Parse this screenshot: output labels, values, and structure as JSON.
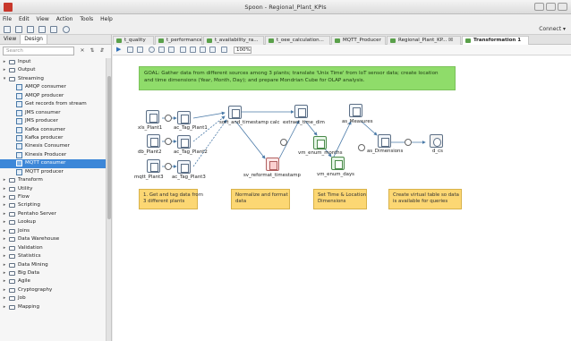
{
  "window": {
    "title": "Spoon - Regional_Plant_KPIs"
  },
  "menu": [
    "File",
    "Edit",
    "View",
    "Action",
    "Tools",
    "Help"
  ],
  "toolbar": {
    "connect_label": "Connect ▾"
  },
  "left_panel": {
    "tabs": [
      "View",
      "Design"
    ],
    "search_placeholder": "Search",
    "tree": [
      {
        "label": "Input",
        "type": "folder",
        "expanded": false
      },
      {
        "label": "Output",
        "type": "folder",
        "expanded": false
      },
      {
        "label": "Streaming",
        "type": "folder",
        "expanded": true
      },
      {
        "label": "AMQP consumer",
        "type": "step"
      },
      {
        "label": "AMQP producer",
        "type": "step"
      },
      {
        "label": "Get records from stream",
        "type": "step"
      },
      {
        "label": "JMS consumer",
        "type": "step"
      },
      {
        "label": "JMS producer",
        "type": "step"
      },
      {
        "label": "Kafka consumer",
        "type": "step"
      },
      {
        "label": "Kafka producer",
        "type": "step"
      },
      {
        "label": "Kinesis Consumer",
        "type": "step"
      },
      {
        "label": "Kinesis Producer",
        "type": "step"
      },
      {
        "label": "MQTT consumer",
        "type": "step",
        "selected": true
      },
      {
        "label": "MQTT producer",
        "type": "step"
      },
      {
        "label": "Transform",
        "type": "folder",
        "expanded": false
      },
      {
        "label": "Utility",
        "type": "folder",
        "expanded": false
      },
      {
        "label": "Flow",
        "type": "folder",
        "expanded": false
      },
      {
        "label": "Scripting",
        "type": "folder",
        "expanded": false
      },
      {
        "label": "Pentaho Server",
        "type": "folder",
        "expanded": false
      },
      {
        "label": "Lookup",
        "type": "folder",
        "expanded": false
      },
      {
        "label": "Joins",
        "type": "folder",
        "expanded": false
      },
      {
        "label": "Data Warehouse",
        "type": "folder",
        "expanded": false
      },
      {
        "label": "Validation",
        "type": "folder",
        "expanded": false
      },
      {
        "label": "Statistics",
        "type": "folder",
        "expanded": false
      },
      {
        "label": "Data Mining",
        "type": "folder",
        "expanded": false
      },
      {
        "label": "Big Data",
        "type": "folder",
        "expanded": false
      },
      {
        "label": "Agile",
        "type": "folder",
        "expanded": false
      },
      {
        "label": "Cryptography",
        "type": "folder",
        "expanded": false
      },
      {
        "label": "Job",
        "type": "folder",
        "expanded": false
      },
      {
        "label": "Mapping",
        "type": "folder",
        "expanded": false
      }
    ]
  },
  "editor_tabs": [
    {
      "label": "t_quality"
    },
    {
      "label": "t_performance"
    },
    {
      "label": "t_availability_ra..."
    },
    {
      "label": "t_oee_calculation..."
    },
    {
      "label": "MQTT_Producer"
    },
    {
      "label": "Regional_Plant_KP... ☒"
    },
    {
      "label": "Transformation 1",
      "active": true
    }
  ],
  "canvas_toolbar": {
    "zoom": "100%"
  },
  "canvas": {
    "goal_note": [
      "GOAL: Gather data from different sources among 3 plants; translate 'Unix Time' from IoT sensor data; create location",
      "and time dimensions (Year, Month, Day); and prepare Mondrian Cube for OLAP analysis."
    ],
    "notes": [
      [
        "1. Get and tag data from",
        "3 different plants"
      ],
      [
        "Normalize and format",
        "data"
      ],
      [
        "Set Time & Location",
        "Dimensions"
      ],
      [
        "Create virtual table so data",
        "is available for queries"
      ]
    ],
    "steps": {
      "s1": "xls_Plant1",
      "s2": "ac_Tag_Plant1",
      "s3": "db_Plant2",
      "s4": "ac_Tag_Plant2",
      "s5": "mqtt_Plant3",
      "s6": "ac_Tag_Plant3",
      "s7": "sort_and_timestamp calc",
      "s8": "extract_time_dim",
      "s9": "as_Measures",
      "s10": "vm_enum_months",
      "s11": "as_Dimensions",
      "s12": "d_cs",
      "s13": "sv_reformat_timestamp",
      "s14": "vm_enum_days"
    }
  }
}
